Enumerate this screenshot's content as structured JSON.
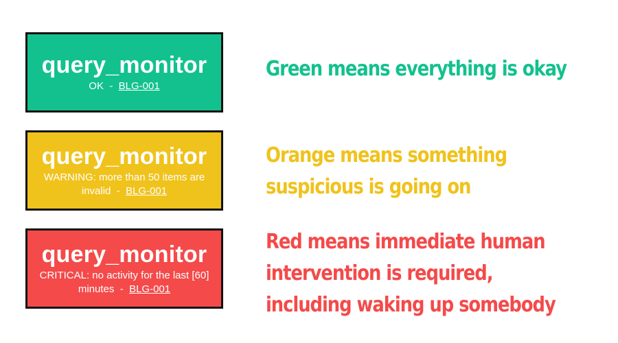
{
  "colors": {
    "ok": "#12c18e",
    "warning": "#f0c21c",
    "critical": "#f44a4a",
    "border": "#111111"
  },
  "cards": [
    {
      "title": "query_monitor",
      "status_text": "OK",
      "separator": "  -  ",
      "code": "BLG-001"
    },
    {
      "title": "query_monitor",
      "status_text": "WARNING: more than 50 items are invalid",
      "separator": "  -  ",
      "code": "BLG-001"
    },
    {
      "title": "query_monitor",
      "status_text": "CRITICAL: no activity for the last [60] minutes",
      "separator": "  -  ",
      "code": "BLG-001"
    }
  ],
  "captions": {
    "green": [
      "Green means everything is okay"
    ],
    "orange": [
      "Orange means something",
      "suspicious is going on"
    ],
    "red": [
      "Red means immediate human",
      "intervention is required,",
      "including waking up somebody"
    ]
  }
}
